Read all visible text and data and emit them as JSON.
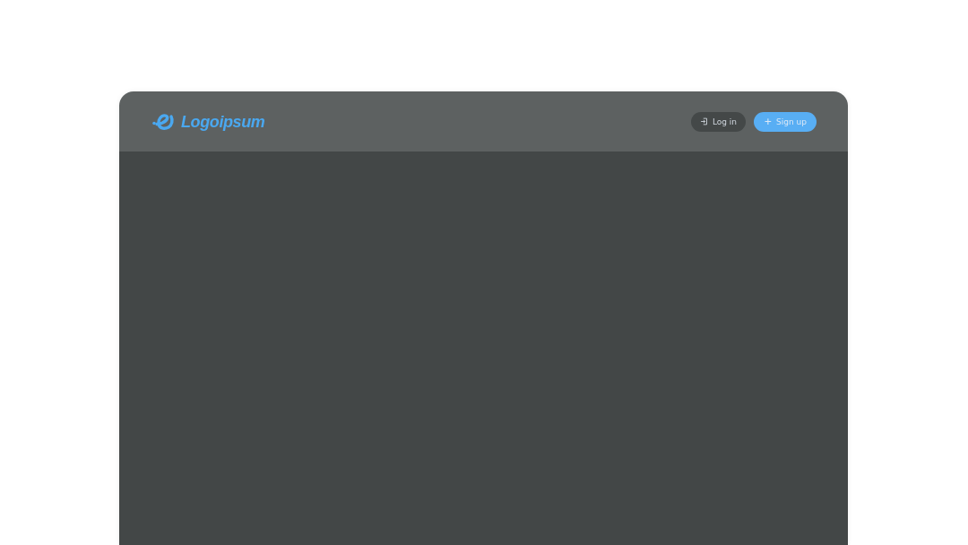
{
  "header": {
    "logo": {
      "text": "Logoipsum"
    },
    "buttons": [
      {
        "kind": "secondary",
        "label": "Log in"
      },
      {
        "kind": "primary",
        "label": "Sign up"
      }
    ]
  }
}
